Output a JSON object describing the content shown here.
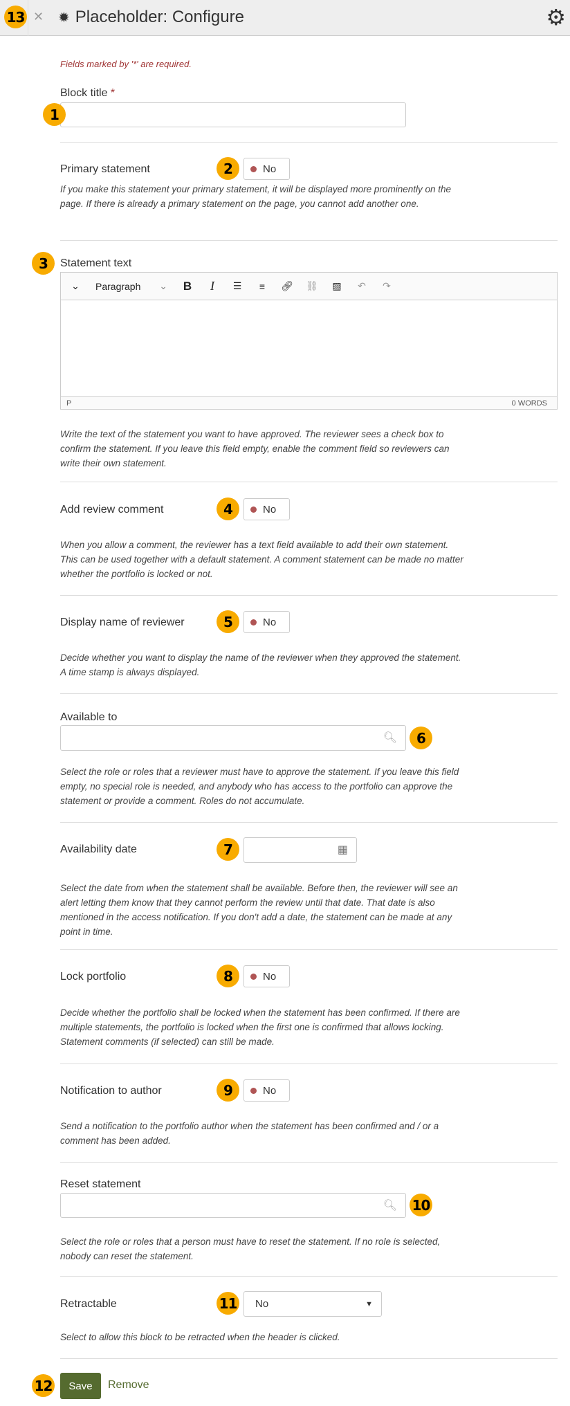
{
  "header": {
    "title": "Placeholder: Configure",
    "close_icon": "close-icon",
    "title_icon": "gear-icon",
    "config_icon": "gears-icon",
    "bg": "#eeeeee"
  },
  "required_note": "Fields marked by '*' are required.",
  "block_title": {
    "label": "Block title",
    "required_mark": "*",
    "value": ""
  },
  "primary_statement": {
    "label": "Primary statement",
    "value": "No",
    "help": "If you make this statement your primary statement, it will be displayed more prominently on the page. If there is already a primary statement on the page, you cannot add another one."
  },
  "statement_text": {
    "label": "Statement text",
    "format": "Paragraph",
    "status_path": "P",
    "word_count": "0 WORDS",
    "help": "Write the text of the statement you want to have approved. The reviewer sees a check box to confirm the statement. If you leave this field empty, enable the comment field so reviewers can write their own statement.",
    "toolbar_icons": [
      "chevron-down-icon",
      "bold-icon",
      "italic-icon",
      "bullet-list-icon",
      "numbered-list-icon",
      "link-icon",
      "unlink-icon",
      "image-icon",
      "undo-icon",
      "redo-icon"
    ]
  },
  "add_review_comment": {
    "label": "Add review comment",
    "value": "No",
    "help": "When you allow a comment, the reviewer has a text field available to add their own statement. This can be used together with a default statement. A comment statement can be made no matter whether the portfolio is locked or not."
  },
  "display_name": {
    "label": "Display name of reviewer",
    "value": "No",
    "help": "Decide whether you want to display the name of the reviewer when they approved the statement. A time stamp is always displayed."
  },
  "available_to": {
    "label": "Available to",
    "value": "",
    "help": "Select the role or roles that a reviewer must have to approve the statement. If you leave this field empty, no special role is needed, and anybody who has access to the portfolio can approve the statement or provide a comment. Roles do not accumulate."
  },
  "availability_date": {
    "label": "Availability date",
    "value": "",
    "help": "Select the date from when the statement shall be available. Before then, the reviewer will see an alert letting them know that they cannot perform the review until that date. That date is also mentioned in the access notification. If you don't add a date, the statement can be made at any point in time."
  },
  "lock_portfolio": {
    "label": "Lock portfolio",
    "value": "No",
    "help": "Decide whether the portfolio shall be locked when the statement has been confirmed. If there are multiple statements, the portfolio is locked when the first one is confirmed that allows locking. Statement comments (if selected) can still be made."
  },
  "notification": {
    "label": "Notification to author",
    "value": "No",
    "help": "Send a notification to the portfolio author when the statement has been confirmed and / or a comment has been added."
  },
  "reset_statement": {
    "label": "Reset statement",
    "value": "",
    "help": "Select the role or roles that a person must have to reset the statement. If no role is selected, nobody can reset the statement."
  },
  "retractable": {
    "label": "Retractable",
    "value": "No",
    "help": "Select to allow this block to be retracted when the header is clicked."
  },
  "actions": {
    "save": "Save",
    "remove": "Remove"
  },
  "badges": [
    "1",
    "2",
    "3",
    "4",
    "5",
    "6",
    "7",
    "8",
    "9",
    "10",
    "11",
    "12",
    "13"
  ],
  "colors": {
    "badge": "#f8ab00",
    "save": "#556b2f",
    "required": "#a03434",
    "toggle_off": "#b05555"
  }
}
